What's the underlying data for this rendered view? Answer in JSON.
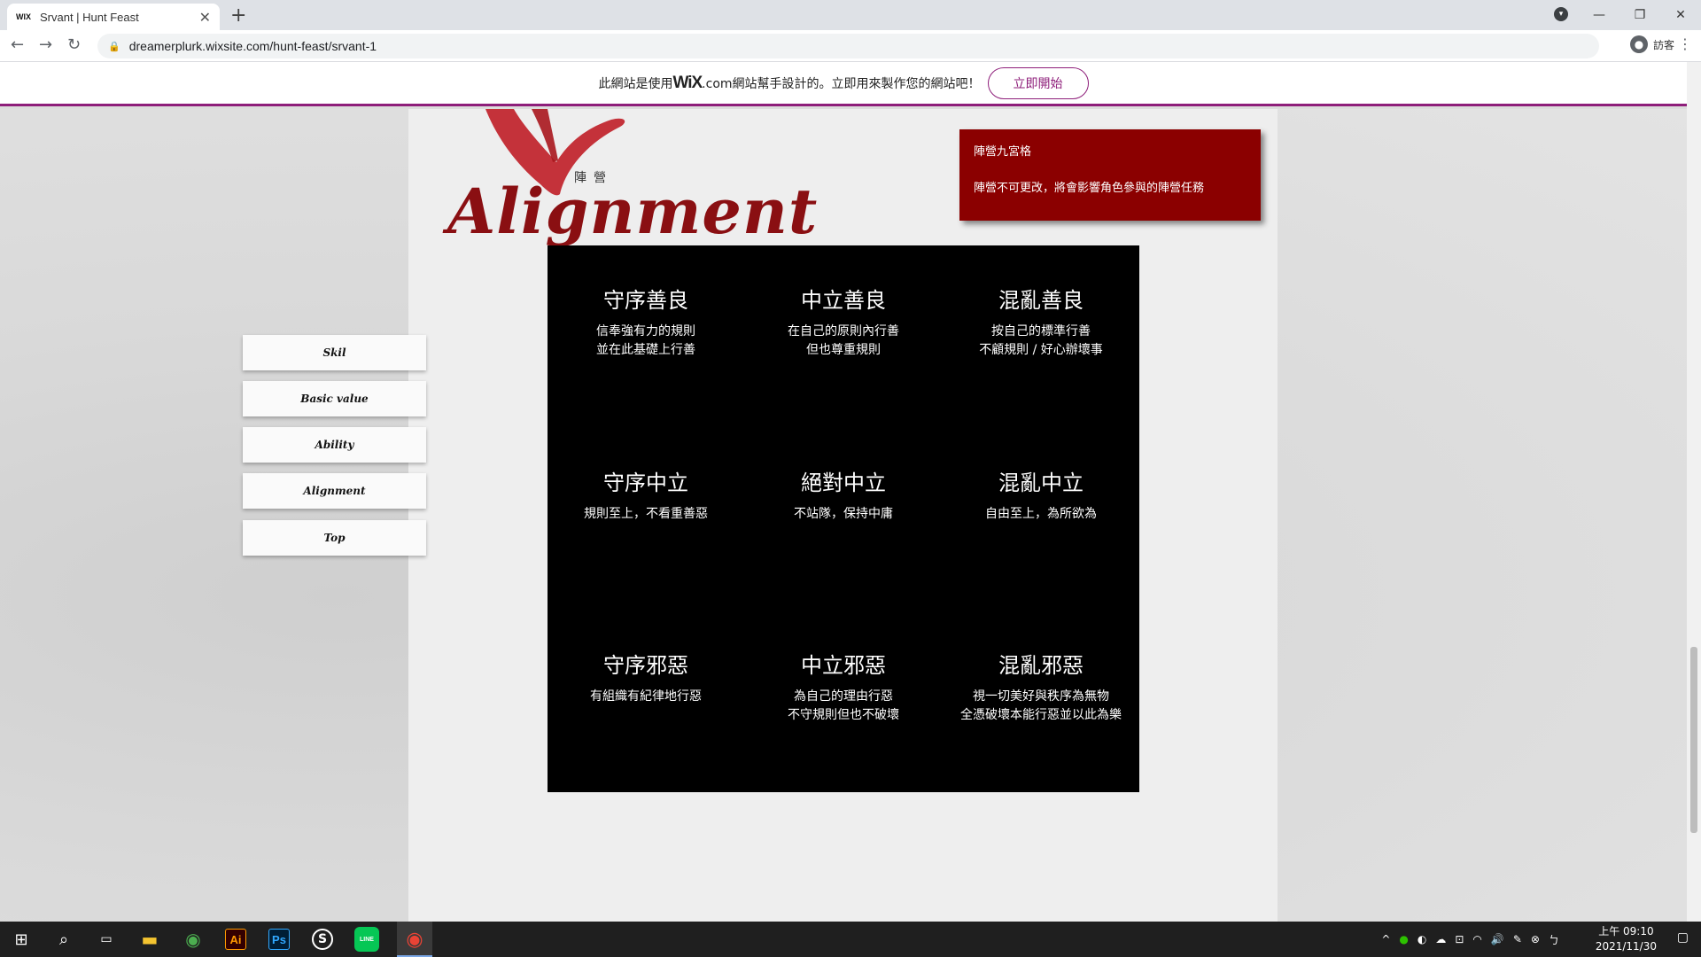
{
  "browser": {
    "tab_favicon": "WIX",
    "tab_title": "Srvant | Hunt Feast",
    "tab_close": "✕",
    "new_tab": "+",
    "url": "dreamerplurk.wixsite.com/hunt-feast/srvant-1",
    "profile_name": "訪客",
    "back": "←",
    "forward": "→",
    "reload": "↻",
    "lock": "🔒",
    "menu": "⋮",
    "win_min": "—",
    "win_max": "❐",
    "win_close": "✕",
    "tab_search": "▾",
    "avatar_glyph": "●"
  },
  "wix_banner": {
    "msg_before": "此網站是使用",
    "brand": "WiX",
    "msg_after": ".com網站幫手設計的。立即用來製作您的網站吧！",
    "cta": "立即開始"
  },
  "heading": {
    "sub": "陣營",
    "title": "Alignment"
  },
  "note": {
    "line1": "陣營九宮格",
    "line2": "陣營不可更改，將會影響角色參與的陣營任務"
  },
  "side_nav": [
    {
      "label": "Skil"
    },
    {
      "label": "Basic value"
    },
    {
      "label": "Ability"
    },
    {
      "label": "Alignment"
    },
    {
      "label": "Top"
    }
  ],
  "alignment_grid": [
    {
      "name": "守序善良",
      "desc": "信奉強有力的規則\n並在此基礎上行善"
    },
    {
      "name": "中立善良",
      "desc": "在自己的原則內行善\n但也尊重規則"
    },
    {
      "name": "混亂善良",
      "desc": "按自己的標準行善\n不顧規則 / 好心辦壞事"
    },
    {
      "name": "守序中立",
      "desc": "規則至上，不看重善惡"
    },
    {
      "name": "絕對中立",
      "desc": "不站隊，保持中庸"
    },
    {
      "name": "混亂中立",
      "desc": "自由至上，為所欲為"
    },
    {
      "name": "守序邪惡",
      "desc": "有組織有紀律地行惡"
    },
    {
      "name": "中立邪惡",
      "desc": "為自己的理由行惡\n不守規則但也不破壞"
    },
    {
      "name": "混亂邪惡",
      "desc": "視一切美好與秩序為無物\n全憑破壞本能行惡並以此為樂"
    }
  ],
  "taskbar": {
    "start": "⊞",
    "search": "⌕",
    "taskview": "▭",
    "explorer": "▬",
    "chrome_user": "◉",
    "illustrator": "Ai",
    "photoshop": "Ps",
    "app_s": "S",
    "line": "LINE",
    "chrome": "◉",
    "tray_up": "^",
    "tray_wechat": "●",
    "tray_discord": "◐",
    "tray_cloud": "☁",
    "tray_usb": "⊡",
    "tray_wifi": "◠",
    "tray_volume": "🔊",
    "tray_pen": "✎",
    "tray_x": "⊗",
    "tray_ime": "ㄅ",
    "time": "上午 09:10",
    "date": "2021/11/30",
    "notifications": "▢"
  },
  "colors": {
    "accent_wix": "#8e1e7a",
    "heading_red": "#8a0f12",
    "note_bg": "#8b0000",
    "grid_bg": "#000000"
  }
}
